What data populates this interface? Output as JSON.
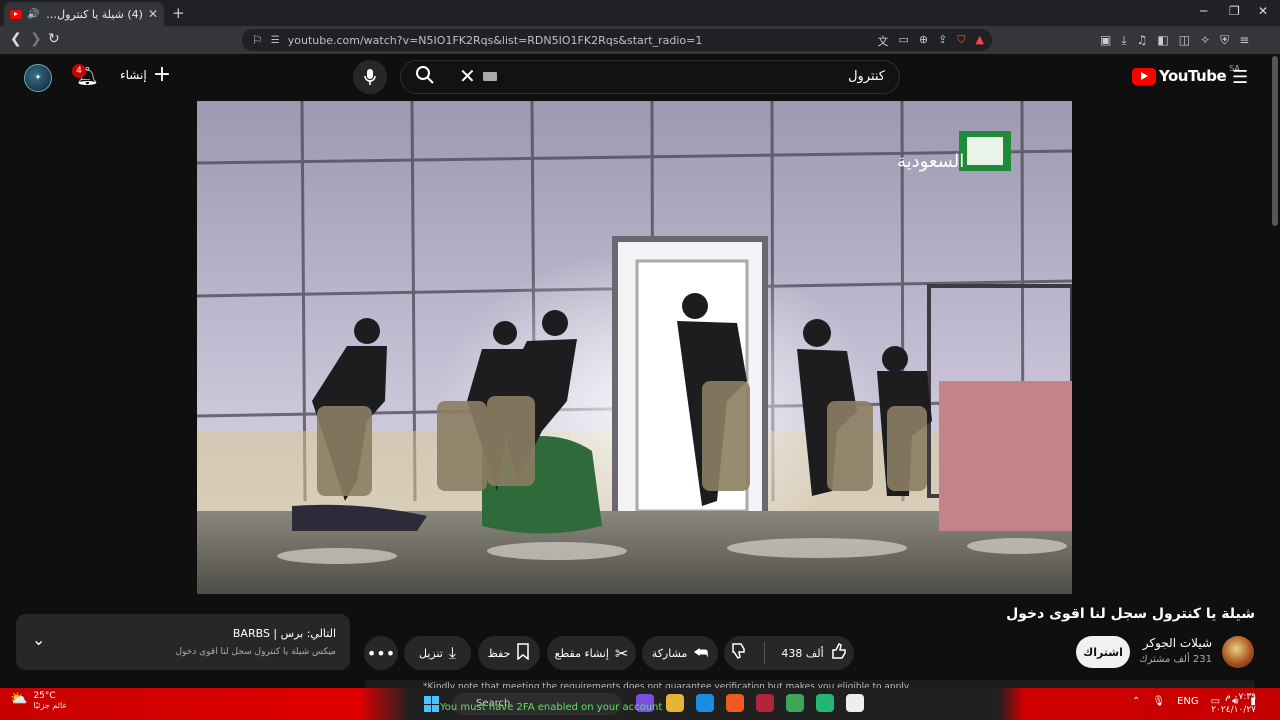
{
  "browser": {
    "tab_title": "(4) شيلة يا كنترول سجل لنا اقوى دخول",
    "url": "youtube.com/watch?v=N5IO1FK2Rqs&list=RDN5IO1FK2Rqs&start_radio=1"
  },
  "header": {
    "notification_count": "4",
    "create_label": "إنشاء",
    "search_value": "كنترول",
    "logo_text": "YouTube",
    "country_code": "SA"
  },
  "video": {
    "channel_watermark": "السعودية",
    "title": "شيلة يا كنترول سجل لنا اقوى دخول"
  },
  "channel": {
    "name": "شيلات الجوكر",
    "subscribers": "231 ألف مشترك",
    "subscribe_label": "اشتراك"
  },
  "actions": {
    "like_count": "438 ألف",
    "share_label": "مشاركة",
    "clip_label": "إنشاء مقطع",
    "save_label": "حفظ",
    "download_label": "تنزيل"
  },
  "next_card": {
    "line1": "التالي: برس | BARBS",
    "line2": "ميكس شيلة يا كنترول سجل لنا اقوى دخول"
  },
  "hint_strip": "*Kindly note that meeting the requirements does not guarantee verification but makes you eligible to apply.",
  "taskbar": {
    "temperature": "25°C",
    "weather_desc": "غائم جزئيًا",
    "search_label": "Search",
    "notice_text": "You must have 2FA enabled on your account",
    "language": "ENG",
    "time": "٠٧:٣٩ م",
    "date": "٢٠٢٤/١٠/٢٧"
  }
}
